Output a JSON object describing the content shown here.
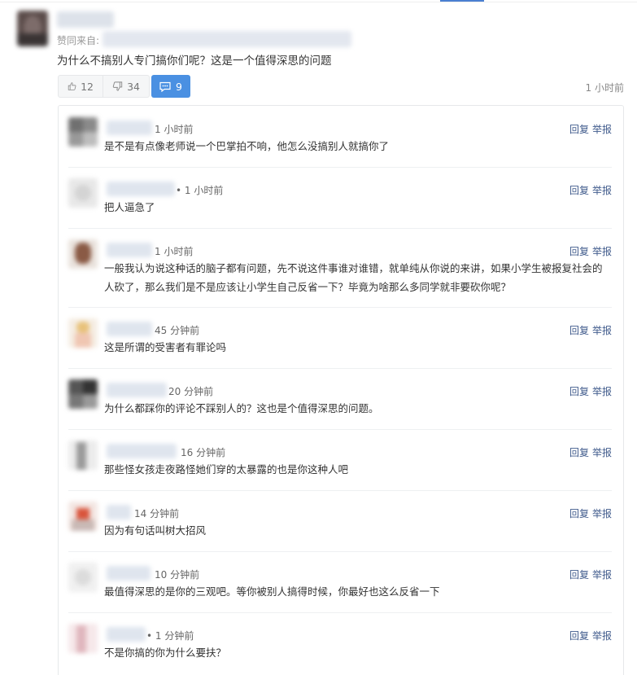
{
  "comment": {
    "support_label": "赞同来自:",
    "content": "为什么不搞别人专门搞你们呢？这是一个值得深思的问题",
    "upvotes": "12",
    "downvotes": "34",
    "reply_count": "9",
    "time": "1 小时前"
  },
  "reply_actions": {
    "reply_label": "回复",
    "report_label": "举报"
  },
  "replies": [
    {
      "time": "1 小时前",
      "text": "是不是有点像老师说一个巴掌拍不响，他怎么没搞别人就搞你了"
    },
    {
      "time": "• 1 小时前",
      "text": "把人逼急了"
    },
    {
      "time": "1 小时前",
      "text": "一般我认为说这种话的脑子都有问题，先不说这件事谁对谁错，就单纯从你说的来讲，如果小学生被报复社会的人砍了，那么我们是不是应该让小学生自己反省一下？毕竟为啥那么多同学就非要砍你呢？"
    },
    {
      "time": "45 分钟前",
      "text": "这是所谓的受害者有罪论吗"
    },
    {
      "time": "20 分钟前",
      "text": "为什么都踩你的评论不踩别人的？这也是个值得深思的问题。"
    },
    {
      "time": "16 分钟前",
      "text": "那些怪女孩走夜路怪她们穿的太暴露的也是你这种人吧"
    },
    {
      "time": "14 分钟前",
      "text": "因为有句话叫树大招风"
    },
    {
      "time": "10 分钟前",
      "text": "最值得深思的是你的三观吧。等你被别人搞得时候，你最好也这么反省一下"
    },
    {
      "time": "• 1 分钟前",
      "text": "不是你搞的你为什么要扶？"
    }
  ],
  "colors": {
    "accent": "#4a90e2",
    "link": "#405b8c"
  },
  "icons": {
    "upvote": "thumbs-up-icon",
    "downvote": "thumbs-down-icon",
    "replies": "comment-bubble-icon"
  }
}
